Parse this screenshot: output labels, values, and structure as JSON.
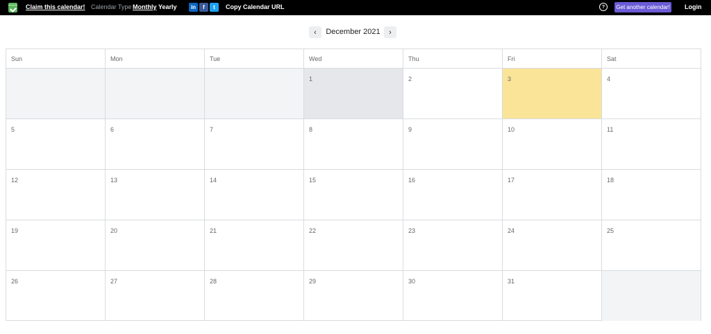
{
  "topbar": {
    "logo_icon": "calendar-check-icon",
    "claim_label": "Claim this calendar!",
    "caltype_label": "Calendar Type",
    "monthly_label": "Monthly",
    "yearly_label": "Yearly",
    "social": {
      "linkedin": "in",
      "facebook": "f",
      "twitter": "t"
    },
    "copy_url_label": "Copy Calendar URL",
    "help_icon": "question-circle-icon",
    "get_calendar_label": "Get another calendar!",
    "login_label": "Login",
    "colors": {
      "bar_bg": "#000000",
      "accent_button": "#6b5bd6"
    }
  },
  "nav": {
    "prev_icon": "chevron-left-icon",
    "next_icon": "chevron-right-icon",
    "prev_glyph": "‹",
    "next_glyph": "›",
    "month_title": "December 2021"
  },
  "calendar": {
    "weekdays": [
      "Sun",
      "Mon",
      "Tue",
      "Wed",
      "Thu",
      "Fri",
      "Sat"
    ],
    "weeks": [
      [
        "",
        "",
        "",
        "1",
        "2",
        "3",
        "4"
      ],
      [
        "5",
        "6",
        "7",
        "8",
        "9",
        "10",
        "11"
      ],
      [
        "12",
        "13",
        "14",
        "15",
        "16",
        "17",
        "18"
      ],
      [
        "19",
        "20",
        "21",
        "22",
        "23",
        "24",
        "25"
      ],
      [
        "26",
        "27",
        "28",
        "29",
        "30",
        "31",
        ""
      ]
    ],
    "highlight_colors": {
      "today": "#f9e498",
      "selected": "#e6e7ea",
      "other_month": "#f2f4f5"
    }
  }
}
